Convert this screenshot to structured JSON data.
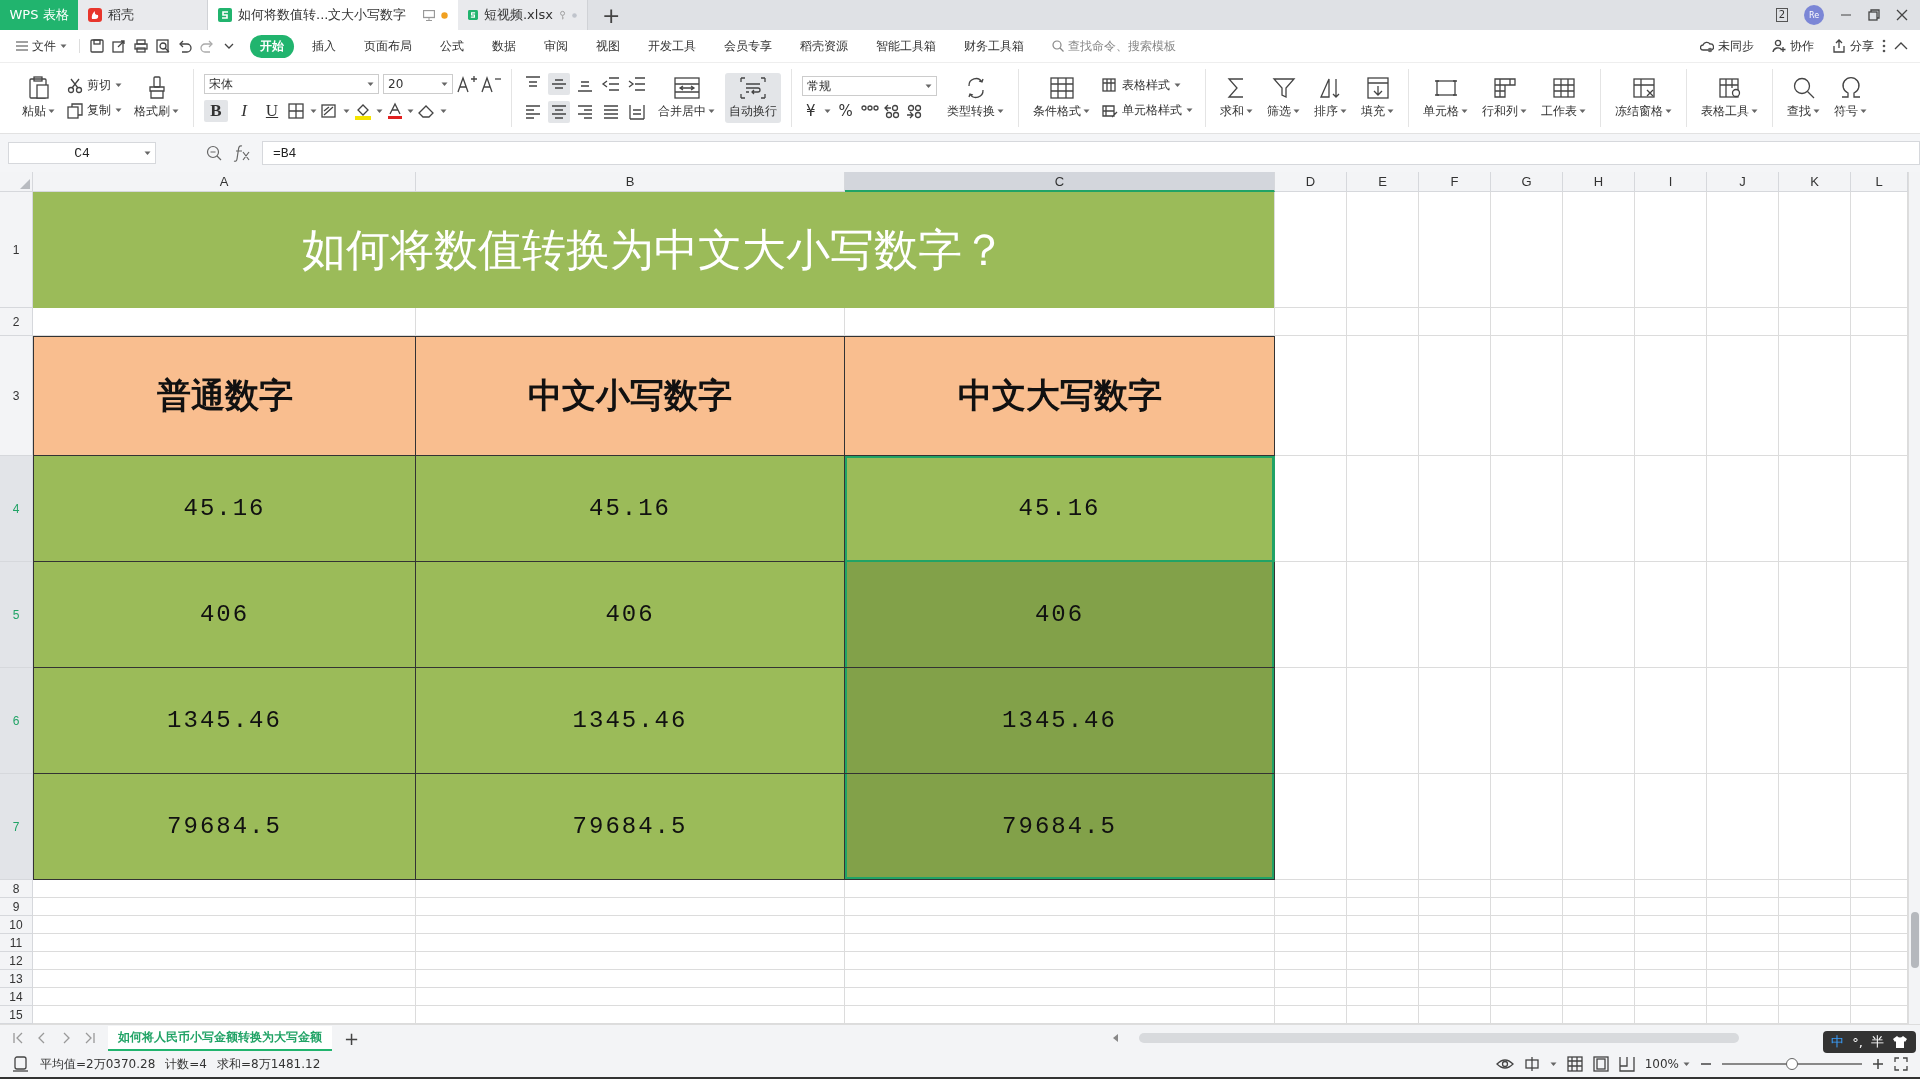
{
  "app_tabs": [
    {
      "label": "WPS 表格",
      "kind": "brand",
      "selected": false
    },
    {
      "label": "稻壳",
      "kind": "daoke",
      "selected": false
    },
    {
      "label": "如何将数值转...文大小写数字",
      "kind": "sheet",
      "selected": true,
      "unsaved": true
    },
    {
      "label": "短视频.xlsx",
      "kind": "sheet",
      "selected": false,
      "unsaved": false
    }
  ],
  "new_tab": "+",
  "window_count": "2",
  "avatar": "Re",
  "menu": {
    "file": "文件",
    "items": [
      {
        "label": "开始",
        "selected": true
      },
      {
        "label": "插入",
        "selected": false
      },
      {
        "label": "页面布局",
        "selected": false
      },
      {
        "label": "公式",
        "selected": false
      },
      {
        "label": "数据",
        "selected": false
      },
      {
        "label": "审阅",
        "selected": false
      },
      {
        "label": "视图",
        "selected": false
      },
      {
        "label": "开发工具",
        "selected": false
      },
      {
        "label": "会员专享",
        "selected": false
      },
      {
        "label": "稻壳资源",
        "selected": false
      },
      {
        "label": "智能工具箱",
        "selected": false
      },
      {
        "label": "财务工具箱",
        "selected": false
      }
    ],
    "search_placeholder": "查找命令、搜索模板",
    "actions": [
      "未同步",
      "协作",
      "分享"
    ]
  },
  "ribbon": {
    "paste": "粘贴",
    "cut": "剪切",
    "copy": "复制",
    "format_painter": "格式刷",
    "font_name": "宋体",
    "font_size": "20",
    "font_styles": [
      {
        "label": "B",
        "selected": true
      },
      {
        "label": "I",
        "selected": false
      },
      {
        "label": "U",
        "selected": false
      }
    ],
    "alignment": [
      {
        "selected": false
      },
      {
        "selected": true
      },
      {
        "selected": false
      },
      {
        "selected": false
      },
      {
        "selected": false
      },
      {
        "selected": false
      },
      {
        "selected": true
      },
      {
        "selected": false
      },
      {
        "selected": false
      },
      {
        "selected": false
      }
    ],
    "merge": "合并居中",
    "wrap": {
      "label": "自动换行",
      "selected": true
    },
    "number_format": "常规",
    "currency": "¥",
    "percent": "%",
    "convert": "类型转换",
    "conditional": "条件格式",
    "table_style": "表格样式",
    "cell_style": "单元格样式",
    "tools": [
      "求和",
      "筛选",
      "排序",
      "填充",
      "单元格",
      "行和列",
      "工作表",
      "冻结窗格",
      "表格工具",
      "查找",
      "符号"
    ]
  },
  "formula_bar": {
    "name_box": "C4",
    "formula": "=B4"
  },
  "columns": [
    {
      "label": "A",
      "selected": false
    },
    {
      "label": "B",
      "selected": false
    },
    {
      "label": "C",
      "selected": true
    },
    {
      "label": "D",
      "selected": false
    },
    {
      "label": "E",
      "selected": false
    },
    {
      "label": "F",
      "selected": false
    },
    {
      "label": "G",
      "selected": false
    },
    {
      "label": "H",
      "selected": false
    },
    {
      "label": "I",
      "selected": false
    },
    {
      "label": "J",
      "selected": false
    },
    {
      "label": "K",
      "selected": false
    },
    {
      "label": "L",
      "selected": false
    }
  ],
  "rows": [
    {
      "label": "1",
      "selected": false
    },
    {
      "label": "2",
      "selected": false
    },
    {
      "label": "3",
      "selected": false
    },
    {
      "label": "4",
      "selected": true
    },
    {
      "label": "5",
      "selected": true
    },
    {
      "label": "6",
      "selected": true
    },
    {
      "label": "7",
      "selected": true
    },
    {
      "label": "8",
      "selected": false
    },
    {
      "label": "9",
      "selected": false
    },
    {
      "label": "10",
      "selected": false
    },
    {
      "label": "11",
      "selected": false
    },
    {
      "label": "12",
      "selected": false
    },
    {
      "label": "13",
      "selected": false
    },
    {
      "label": "14",
      "selected": false
    },
    {
      "label": "15",
      "selected": false
    }
  ],
  "sheet": {
    "title": "如何将数值转换为中文大小写数字？",
    "headers": [
      "普通数字",
      "中文小写数字",
      "中文大写数字"
    ],
    "data": [
      [
        {
          "text": "45.16",
          "selected": false,
          "active": false
        },
        {
          "text": "45.16",
          "selected": false,
          "active": false
        },
        {
          "text": "45.16",
          "selected": true,
          "active": true
        }
      ],
      [
        {
          "text": "406",
          "selected": false,
          "active": false
        },
        {
          "text": "406",
          "selected": false,
          "active": false
        },
        {
          "text": "406",
          "selected": true,
          "active": false
        }
      ],
      [
        {
          "text": "1345.46",
          "selected": false,
          "active": false
        },
        {
          "text": "1345.46",
          "selected": false,
          "active": false
        },
        {
          "text": "1345.46",
          "selected": true,
          "active": false
        }
      ],
      [
        {
          "text": "79684.5",
          "selected": false,
          "active": false
        },
        {
          "text": "79684.5",
          "selected": false,
          "active": false
        },
        {
          "text": "79684.5",
          "selected": true,
          "active": false
        }
      ]
    ]
  },
  "sheet_tabs": [
    {
      "label": "如何将人民币小写金额转换为大写金额",
      "selected": true
    }
  ],
  "add_sheet": "+",
  "status": {
    "stats": [
      "平均值=2万0370.28",
      "计数=4",
      "求和=8万1481.12"
    ],
    "zoom": "100%",
    "zoom_slider": {
      "level": 0.5
    }
  },
  "ime": [
    "中",
    "°,",
    "半"
  ]
}
